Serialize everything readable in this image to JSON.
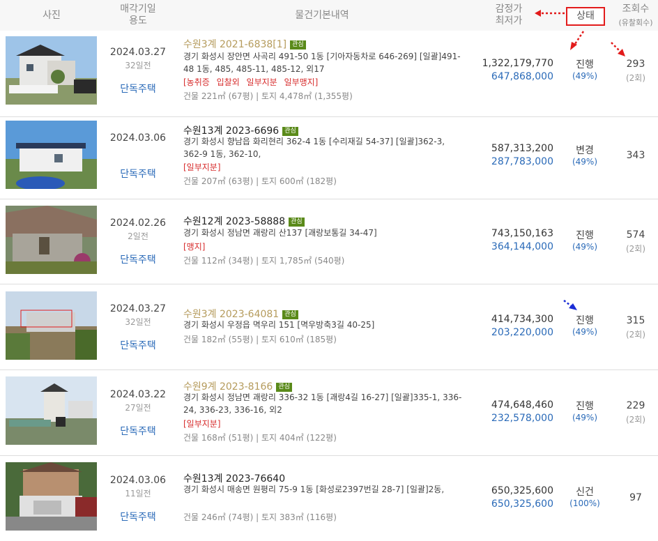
{
  "header": {
    "photo": "사진",
    "sale_date": "매각기일",
    "usage": "용도",
    "details": "물건기본내역",
    "appraisal": "감정가",
    "min_price": "최저가",
    "status": "상태",
    "views": "조회수",
    "failed": "(유찰회수)"
  },
  "rows": [
    {
      "date": "2024.03.27",
      "days": "32일전",
      "type": "단독주택",
      "case": "수원3계 2021-6838[1]",
      "tag": "관심",
      "addr": "경기 화성시 장안면 사곡리 491-50 1동 [기아자동차로 646-269] [일괄]491-48 1동, 485, 485-11, 485-12, 외17",
      "flags": "[농취증 입찰외 일부지분 일부맹지]",
      "area": "건물 221㎡ (67평)  |  토지 4,478㎡ (1,355평)",
      "appraisal": "1,322,179,770",
      "min": "647,868,000",
      "status": "진행",
      "pct": "(49%)",
      "views": "293",
      "failed": "(2회)"
    },
    {
      "date": "2024.03.06",
      "days": "",
      "type": "단독주택",
      "case": "수원13계 2023-6696",
      "tag": "관심",
      "addr": "경기 화성시 향남읍 화리현리 362-4 1동 [수리재길 54-37] [일괄]362-3, 362-9 1동, 362-10,",
      "flags": "[일부지분]",
      "area": "건물 207㎡ (63평)  |  토지 600㎡ (182평)",
      "appraisal": "587,313,200",
      "min": "287,783,000",
      "status": "변경",
      "pct": "(49%)",
      "views": "343",
      "failed": ""
    },
    {
      "date": "2024.02.26",
      "days": "2일전",
      "type": "단독주택",
      "case": "수원12계 2023-58888",
      "tag": "관심",
      "addr": "경기 화성시 정남면 괘랑리 산137 [괘랑보통길 34-47]",
      "flags": "[맹지]",
      "area": "건물 112㎡ (34평)  |  토지 1,785㎡ (540평)",
      "appraisal": "743,150,163",
      "min": "364,144,000",
      "status": "진행",
      "pct": "(49%)",
      "views": "574",
      "failed": "(2회)"
    },
    {
      "date": "2024.03.27",
      "days": "32일전",
      "type": "단독주택",
      "case": "수원3계 2023-64081",
      "tag": "관심",
      "addr": "경기 화성시 우정읍 멱우리 151 [멱우방축3길 40-25]",
      "flags": "",
      "area": "건물 182㎡ (55평)  |  토지 610㎡ (185평)",
      "appraisal": "414,734,300",
      "min": "203,220,000",
      "status": "진행",
      "pct": "(49%)",
      "views": "315",
      "failed": "(2회)"
    },
    {
      "date": "2024.03.22",
      "days": "27일전",
      "type": "단독주택",
      "case": "수원9계 2023-8166",
      "tag": "관심",
      "addr": "경기 화성시 정남면 괘랑리 336-32 1동 [괘랑4길 16-27] [일괄]335-1, 336-24, 336-23, 336-16, 외2",
      "flags": "[일부지분]",
      "area": "건물 168㎡ (51평)  |  토지 404㎡ (122평)",
      "appraisal": "474,648,460",
      "min": "232,578,000",
      "status": "진행",
      "pct": "(49%)",
      "views": "229",
      "failed": "(2회)"
    },
    {
      "date": "2024.03.06",
      "days": "11일전",
      "type": "단독주택",
      "case": "수원13계 2023-76640",
      "tag": "",
      "addr": "경기 화성시 매송면 원평리 75-9 1동 [화성로2397번길 28-7] [일괄]2동,",
      "flags": "",
      "area": "건물 246㎡ (74평)  |  토지 383㎡ (116평)",
      "appraisal": "650,325,600",
      "min": "650,325,600",
      "status": "신건",
      "pct": "(100%)",
      "views": "97",
      "failed": ""
    }
  ],
  "colors": {
    "accent": "#2a6ab8",
    "gold": "#b59b5c",
    "red": "#d72c2c",
    "annotation": "#e21b1b",
    "tag": "#5a8a1a"
  }
}
